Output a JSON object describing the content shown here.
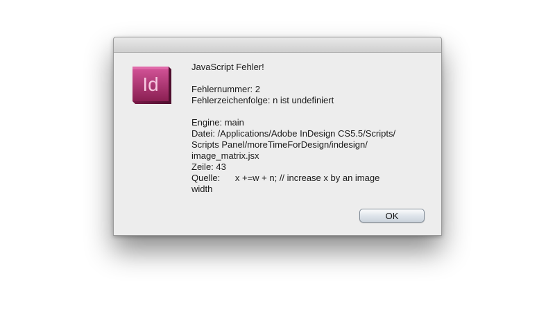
{
  "dialog": {
    "icon": "indesign-app-icon",
    "icon_text": "Id",
    "icon_color": "#b3306f",
    "title": "JavaScript Fehler!",
    "error_number": "Fehlernummer: 2",
    "error_string": "Fehlerzeichenfolge: n ist undefiniert",
    "engine": "Engine: main",
    "file_line1": "Datei: /Applications/Adobe InDesign CS5.5/Scripts/",
    "file_line2": "Scripts Panel/moreTimeForDesign/indesign/",
    "file_line3": "image_matrix.jsx",
    "line_number": "Zeile: 43",
    "source_line1": "Quelle:      x +=w + n; // increase x by an image",
    "source_line2": "width",
    "ok_label": "OK"
  }
}
